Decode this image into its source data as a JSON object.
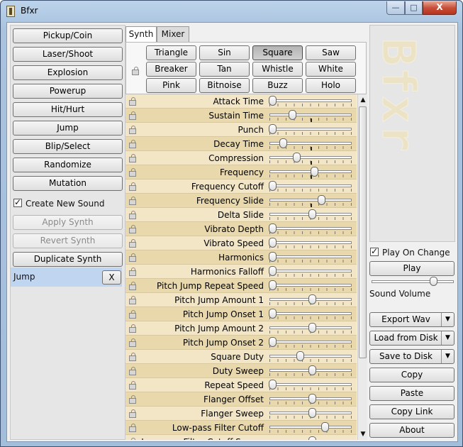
{
  "window": {
    "title": "Bfxr",
    "minimize_glyph": "—",
    "maximize_glyph": "□",
    "close_glyph": "X"
  },
  "generators": [
    "Pickup/Coin",
    "Laser/Shoot",
    "Explosion",
    "Powerup",
    "Hit/Hurt",
    "Jump",
    "Blip/Select",
    "Randomize",
    "Mutation"
  ],
  "create_new_sound": {
    "label": "Create New Sound",
    "checked": true
  },
  "synth_actions": {
    "apply": "Apply Synth",
    "revert": "Revert Synth",
    "duplicate": "Duplicate Synth"
  },
  "saved_sounds": [
    {
      "name": "Jump",
      "delete_label": "X"
    }
  ],
  "tabs": [
    {
      "label": "Synth",
      "active": true
    },
    {
      "label": "Mixer",
      "active": false
    }
  ],
  "waveforms": [
    "Triangle",
    "Sin",
    "Square",
    "Saw",
    "Breaker",
    "Tan",
    "Whistle",
    "White",
    "Pink",
    "Bitnoise",
    "Buzz",
    "Holo"
  ],
  "selected_waveform": "Square",
  "parameters": [
    {
      "label": "Attack Time",
      "value": 0.0,
      "center_mark": false
    },
    {
      "label": "Sustain Time",
      "value": 0.25,
      "center_mark": true
    },
    {
      "label": "Punch",
      "value": 0.0,
      "center_mark": false
    },
    {
      "label": "Decay Time",
      "value": 0.13,
      "center_mark": true
    },
    {
      "label": "Compression",
      "value": 0.3,
      "center_mark": true
    },
    {
      "label": "Frequency",
      "value": 0.53,
      "center_mark": true
    },
    {
      "label": "Frequency Cutoff",
      "value": 0.0,
      "center_mark": false
    },
    {
      "label": "Frequency Slide",
      "value": 0.62,
      "center_mark": true
    },
    {
      "label": "Delta Slide",
      "value": 0.5,
      "center_mark": false
    },
    {
      "label": "Vibrato Depth",
      "value": 0.0,
      "center_mark": false
    },
    {
      "label": "Vibrato Speed",
      "value": 0.0,
      "center_mark": false
    },
    {
      "label": "Harmonics",
      "value": 0.0,
      "center_mark": false
    },
    {
      "label": "Harmonics Falloff",
      "value": 0.0,
      "center_mark": false
    },
    {
      "label": "Pitch Jump Repeat Speed",
      "value": 0.0,
      "center_mark": false
    },
    {
      "label": "Pitch Jump Amount 1",
      "value": 0.5,
      "center_mark": false
    },
    {
      "label": "Pitch Jump Onset 1",
      "value": 0.0,
      "center_mark": false
    },
    {
      "label": "Pitch Jump Amount 2",
      "value": 0.5,
      "center_mark": false
    },
    {
      "label": "Pitch Jump Onset 2",
      "value": 0.0,
      "center_mark": false
    },
    {
      "label": "Square Duty",
      "value": 0.35,
      "center_mark": false
    },
    {
      "label": "Duty Sweep",
      "value": 0.5,
      "center_mark": false
    },
    {
      "label": "Repeat Speed",
      "value": 0.0,
      "center_mark": false
    },
    {
      "label": "Flanger Offset",
      "value": 0.5,
      "center_mark": false
    },
    {
      "label": "Flanger Sweep",
      "value": 0.5,
      "center_mark": false
    },
    {
      "label": "Low-pass Filter Cutoff",
      "value": 0.66,
      "center_mark": false
    },
    {
      "label": "Low-pass Filter Cutoff Sweep",
      "value": 0.5,
      "center_mark": false
    }
  ],
  "scroll": {
    "up": "▲",
    "down": "▼"
  },
  "logo": "Bfxr",
  "play_on_change": {
    "label": "Play On Change",
    "checked": true
  },
  "play_label": "Play",
  "sound_volume": {
    "label": "Sound Volume",
    "value": 0.75
  },
  "right_actions": [
    {
      "label": "Export Wav",
      "has_dropdown": true
    },
    {
      "label": "Load from Disk",
      "has_dropdown": true
    },
    {
      "label": "Save to Disk",
      "has_dropdown": true
    },
    {
      "label": "Copy",
      "has_dropdown": false
    },
    {
      "label": "Paste",
      "has_dropdown": false
    },
    {
      "label": "Copy Link",
      "has_dropdown": false
    },
    {
      "label": "About",
      "has_dropdown": false
    }
  ],
  "dropdown_glyph": "▼"
}
